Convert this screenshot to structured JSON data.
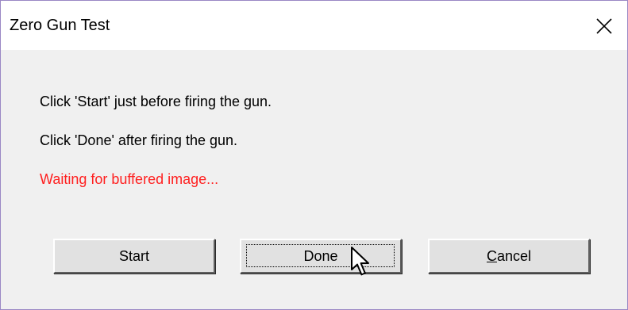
{
  "window": {
    "title": "Zero Gun Test"
  },
  "messages": {
    "line1": "Click 'Start' just before firing the gun.",
    "line2": "Click 'Done' after firing the gun.",
    "status": "Waiting for buffered image...",
    "status_color": "#ff2020"
  },
  "buttons": {
    "start": "Start",
    "done": "Done",
    "cancel_accel": "C",
    "cancel_rest": "ancel"
  },
  "icons": {
    "close": "close-icon",
    "cursor": "mouse-pointer-icon"
  }
}
